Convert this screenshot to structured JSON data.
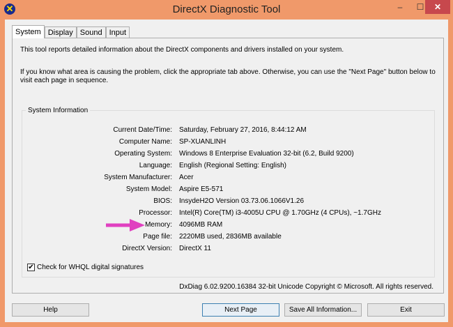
{
  "window": {
    "title": "DirectX Diagnostic Tool",
    "min": "–",
    "max": "☐",
    "close": "✕"
  },
  "tabs": [
    "System",
    "Display",
    "Sound",
    "Input"
  ],
  "intro": {
    "line1": "This tool reports detailed information about the DirectX components and drivers installed on your system.",
    "line2": "If you know what area is causing the problem, click the appropriate tab above.  Otherwise, you can use the \"Next Page\" button below to",
    "line3": "visit each page in sequence."
  },
  "system_info": {
    "label": "System Information",
    "rows": [
      {
        "key": "Current Date/Time:",
        "value": "Saturday, February 27, 2016, 8:44:12 AM"
      },
      {
        "key": "Computer Name:",
        "value": "SP-XUANLINH"
      },
      {
        "key": "Operating System:",
        "value": "Windows 8 Enterprise Evaluation 32-bit (6.2, Build 9200)"
      },
      {
        "key": "Language:",
        "value": "English (Regional Setting: English)"
      },
      {
        "key": "System Manufacturer:",
        "value": "Acer"
      },
      {
        "key": "System Model:",
        "value": "Aspire E5-571"
      },
      {
        "key": "BIOS:",
        "value": "InsydeH2O Version 03.73.06.1066V1.26"
      },
      {
        "key": "Processor:",
        "value": "Intel(R) Core(TM) i3-4005U CPU @ 1.70GHz (4 CPUs), ~1.7GHz"
      },
      {
        "key": "Memory:",
        "value": "4096MB RAM"
      },
      {
        "key": "Page file:",
        "value": "2220MB used, 2836MB available"
      },
      {
        "key": "DirectX Version:",
        "value": "DirectX 11"
      }
    ]
  },
  "whql": {
    "label": "Check for WHQL digital signatures",
    "checked": true
  },
  "copyright": "DxDiag 6.02.9200.16384 32-bit Unicode  Copyright © Microsoft. All rights reserved.",
  "buttons": {
    "help": "Help",
    "next": "Next Page",
    "save": "Save All Information...",
    "exit": "Exit"
  },
  "colors": {
    "frame": "#f0996a",
    "close": "#c7484d",
    "annotation_arrow": "#e040c0"
  }
}
